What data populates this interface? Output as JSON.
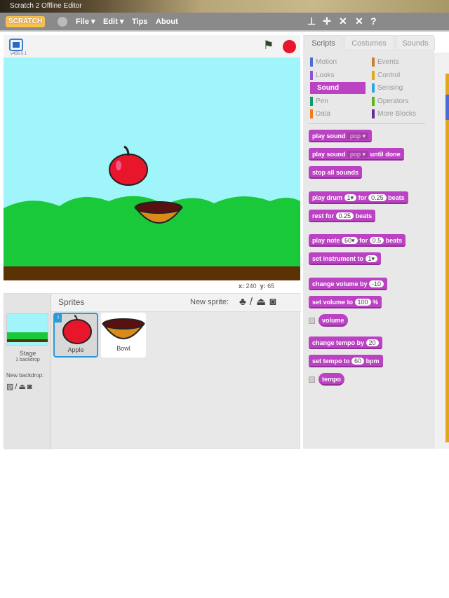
{
  "window": {
    "title": "Scratch 2 Offline Editor"
  },
  "menubar": {
    "logo": "SCRATCH",
    "items": [
      "File ▾",
      "Edit ▾",
      "Tips",
      "About"
    ],
    "tool_icons": [
      "stamp-icon",
      "grow-icon",
      "shrink-icon",
      "fullscreen-icon",
      "help-icon"
    ]
  },
  "stage": {
    "version": "v456.0.1",
    "x_label": "x:",
    "x": "240",
    "y_label": "y:",
    "y": "65"
  },
  "sprites": {
    "title": "Sprites",
    "new_sprite": "New sprite:",
    "stage_label": "Stage",
    "backdrops": "1 backdrop",
    "new_backdrop": "New backdrop:",
    "items": [
      {
        "name": "Apple",
        "selected": true
      },
      {
        "name": "Bowl",
        "selected": false
      }
    ]
  },
  "tabs": [
    "Scripts",
    "Costumes",
    "Sounds"
  ],
  "categories": [
    {
      "label": "Motion",
      "color": "#4a6cd4"
    },
    {
      "label": "Events",
      "color": "#c88330"
    },
    {
      "label": "Looks",
      "color": "#8a55d7"
    },
    {
      "label": "Control",
      "color": "#e1a91a"
    },
    {
      "label": "Sound",
      "color": "#bb42c3",
      "active": true
    },
    {
      "label": "Sensing",
      "color": "#2ca5e2"
    },
    {
      "label": "Pen",
      "color": "#0e9a6c"
    },
    {
      "label": "Operators",
      "color": "#5cb712"
    },
    {
      "label": "Data",
      "color": "#ee7d16"
    },
    {
      "label": "More Blocks",
      "color": "#632d99"
    }
  ],
  "blocks": {
    "b1": [
      "play sound",
      "pop ▾"
    ],
    "b2": [
      "play sound",
      "pop ▾",
      "until done"
    ],
    "b3": [
      "stop all sounds"
    ],
    "b4": [
      "play drum",
      "1▾",
      "for",
      "0.25",
      "beats"
    ],
    "b5": [
      "rest for",
      "0.25",
      "beats"
    ],
    "b6": [
      "play note",
      "60▾",
      "for",
      "0.5",
      "beats"
    ],
    "b7": [
      "set instrument to",
      "1▾"
    ],
    "b8": [
      "change volume by",
      "-10"
    ],
    "b9": [
      "set volume to",
      "100",
      "%"
    ],
    "b10": [
      "volume"
    ],
    "b11": [
      "change tempo by",
      "20"
    ],
    "b12": [
      "set tempo to",
      "60",
      "bpm"
    ],
    "b13": [
      "tempo"
    ]
  }
}
